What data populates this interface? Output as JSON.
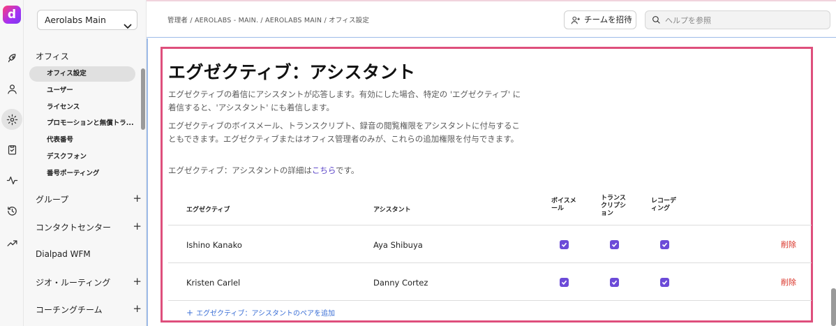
{
  "app": {
    "logo_letter": "d",
    "brand_color": "#a331f5"
  },
  "rail": {
    "icons": [
      "rocket-icon",
      "user-icon",
      "gear-icon",
      "clipboard-icon",
      "pulse-icon",
      "history-icon",
      "trend-icon"
    ],
    "active": "gear-icon"
  },
  "sidebar": {
    "office_select": "Aerolabs Main",
    "office_section": "オフィス",
    "items": [
      {
        "label": "オフィス設定",
        "active": true
      },
      {
        "label": "ユーザー"
      },
      {
        "label": "ライセンス"
      },
      {
        "label": "プロモーションと無償トラ..."
      },
      {
        "label": "代表番号"
      },
      {
        "label": "デスクフォン"
      },
      {
        "label": "番号ポーティング"
      }
    ],
    "groups": [
      {
        "label": "グループ",
        "expandable": true
      },
      {
        "label": "コンタクトセンター",
        "expandable": true
      },
      {
        "label": "Dialpad WFM",
        "expandable": false
      },
      {
        "label": "ジオ・ルーティング",
        "expandable": true
      },
      {
        "label": "コーチングチーム",
        "expandable": true
      }
    ],
    "plus_glyph": "+"
  },
  "header": {
    "breadcrumb": "管理者 / AEROLABS - MAIN. / AEROLABS MAIN / オフィス設定",
    "invite_label": "チームを招待",
    "search_placeholder": "ヘルプを参照"
  },
  "panel": {
    "title": "エグゼクティブ：アシスタント",
    "desc1": "エグゼクティブの着信にアシスタントが応答します。有効にした場合、特定の 'エグゼクティブ' に着信すると、'アシスタント' にも着信します。",
    "desc2": "エグゼクティブのボイスメール、トランスクリプト、録音の閲覧権限をアシスタントに付与することもできます。エグゼクティブまたはオフィス管理者のみが、これらの追加権限を付与できます。",
    "desc3_prefix": "エグゼクティブ：アシスタントの詳細は",
    "desc3_link": "こちら",
    "desc3_suffix": "です。",
    "columns": {
      "executive": "エグゼクティブ",
      "assistant": "アシスタント",
      "voicemail": "ボイスメール",
      "transcription": "トランスクリプション",
      "recording": "レコーディング"
    },
    "rows": [
      {
        "executive": "Ishino Kanako",
        "assistant": "Aya Shibuya",
        "voicemail": true,
        "transcription": true,
        "recording": true,
        "delete_label": "削除"
      },
      {
        "executive": "Kristen Carlel",
        "assistant": "Danny Cortez",
        "voicemail": true,
        "transcription": true,
        "recording": true,
        "delete_label": "削除"
      }
    ],
    "add_plus": "+",
    "add_label": "エグゼクティブ：アシスタントのペアを追加"
  },
  "colors": {
    "accent": "#6c4bd8",
    "panel_border": "#de4f7c",
    "delete": "#d93025",
    "link": "#3b6fd6"
  }
}
